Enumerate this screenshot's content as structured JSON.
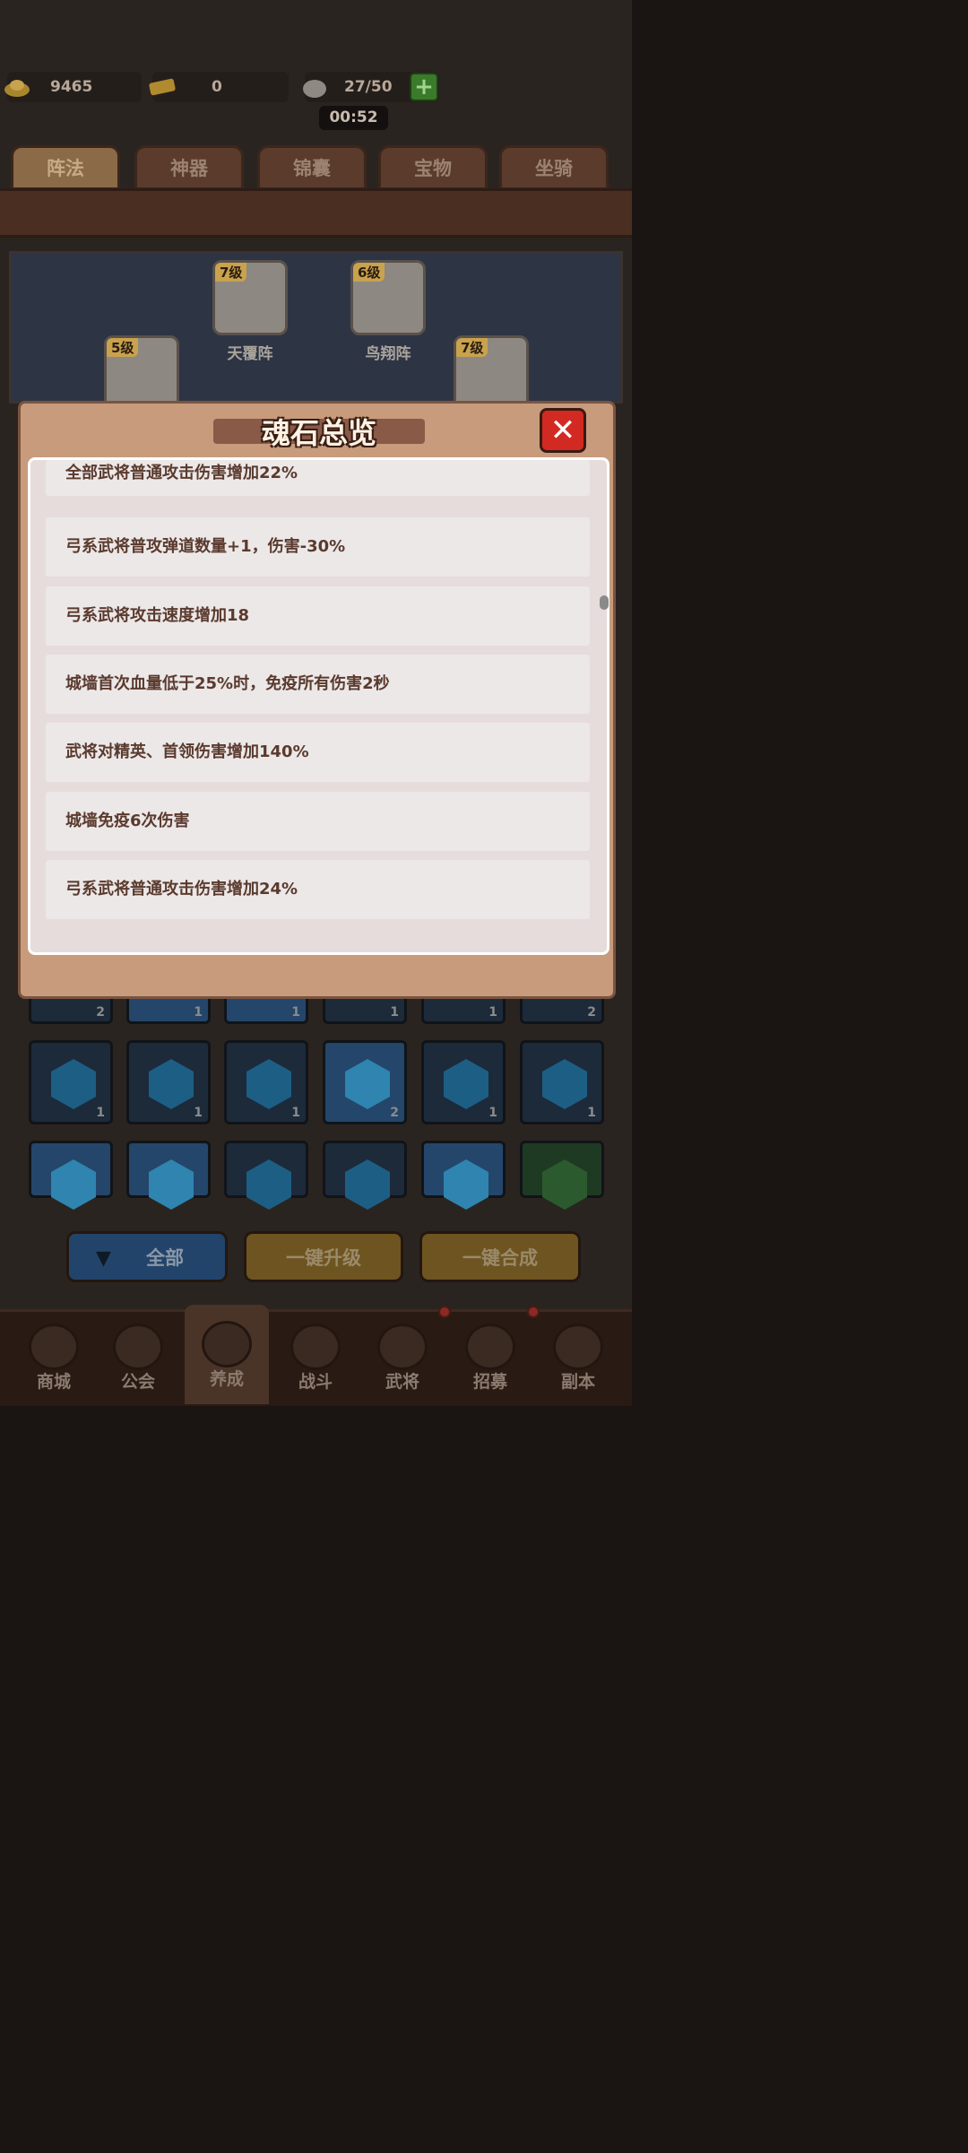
{
  "resources": {
    "gold": "9465",
    "ticket": "0",
    "stamina": "27/50",
    "timer": "00:52"
  },
  "tabs": [
    {
      "label": "阵法",
      "active": true
    },
    {
      "label": "神器"
    },
    {
      "label": "锦囊"
    },
    {
      "label": "宝物"
    },
    {
      "label": "坐骑"
    }
  ],
  "formations": [
    {
      "level": "7级",
      "name": "天覆阵"
    },
    {
      "level": "6级",
      "name": "鸟翔阵"
    },
    {
      "level": "5级",
      "name": ""
    },
    {
      "level": "7级",
      "name": ""
    }
  ],
  "grid_counts": {
    "row1": [
      "2",
      "1",
      "1",
      "1",
      "1",
      "2"
    ],
    "row2": [
      "1",
      "1",
      "1",
      "2",
      "1",
      "1"
    ]
  },
  "buttons": {
    "filter_all": "全部",
    "upgrade_all": "一键升级",
    "merge_all": "一键合成"
  },
  "nav": [
    {
      "label": "商城"
    },
    {
      "label": "公会"
    },
    {
      "label": "养成",
      "active": true
    },
    {
      "label": "战斗"
    },
    {
      "label": "武将"
    },
    {
      "label": "招募"
    },
    {
      "label": "副本"
    }
  ],
  "modal": {
    "title": "魂石总览",
    "close_symbol": "✕",
    "effects": [
      "全部武将普通攻击伤害增加22%",
      "弓系武将普攻弹道数量+1，伤害-30%",
      "弓系武将攻击速度增加18",
      "城墙首次血量低于25%时，免疫所有伤害2秒",
      "武将对精英、首领伤害增加140%",
      "城墙免疫6次伤害",
      "弓系武将普通攻击伤害增加24%"
    ]
  },
  "colors": {
    "modal_bg": "#c79b7c",
    "panel_bg": "#e6dcdc",
    "text_brown": "#5a3a2e",
    "close_red": "#d22a22"
  }
}
